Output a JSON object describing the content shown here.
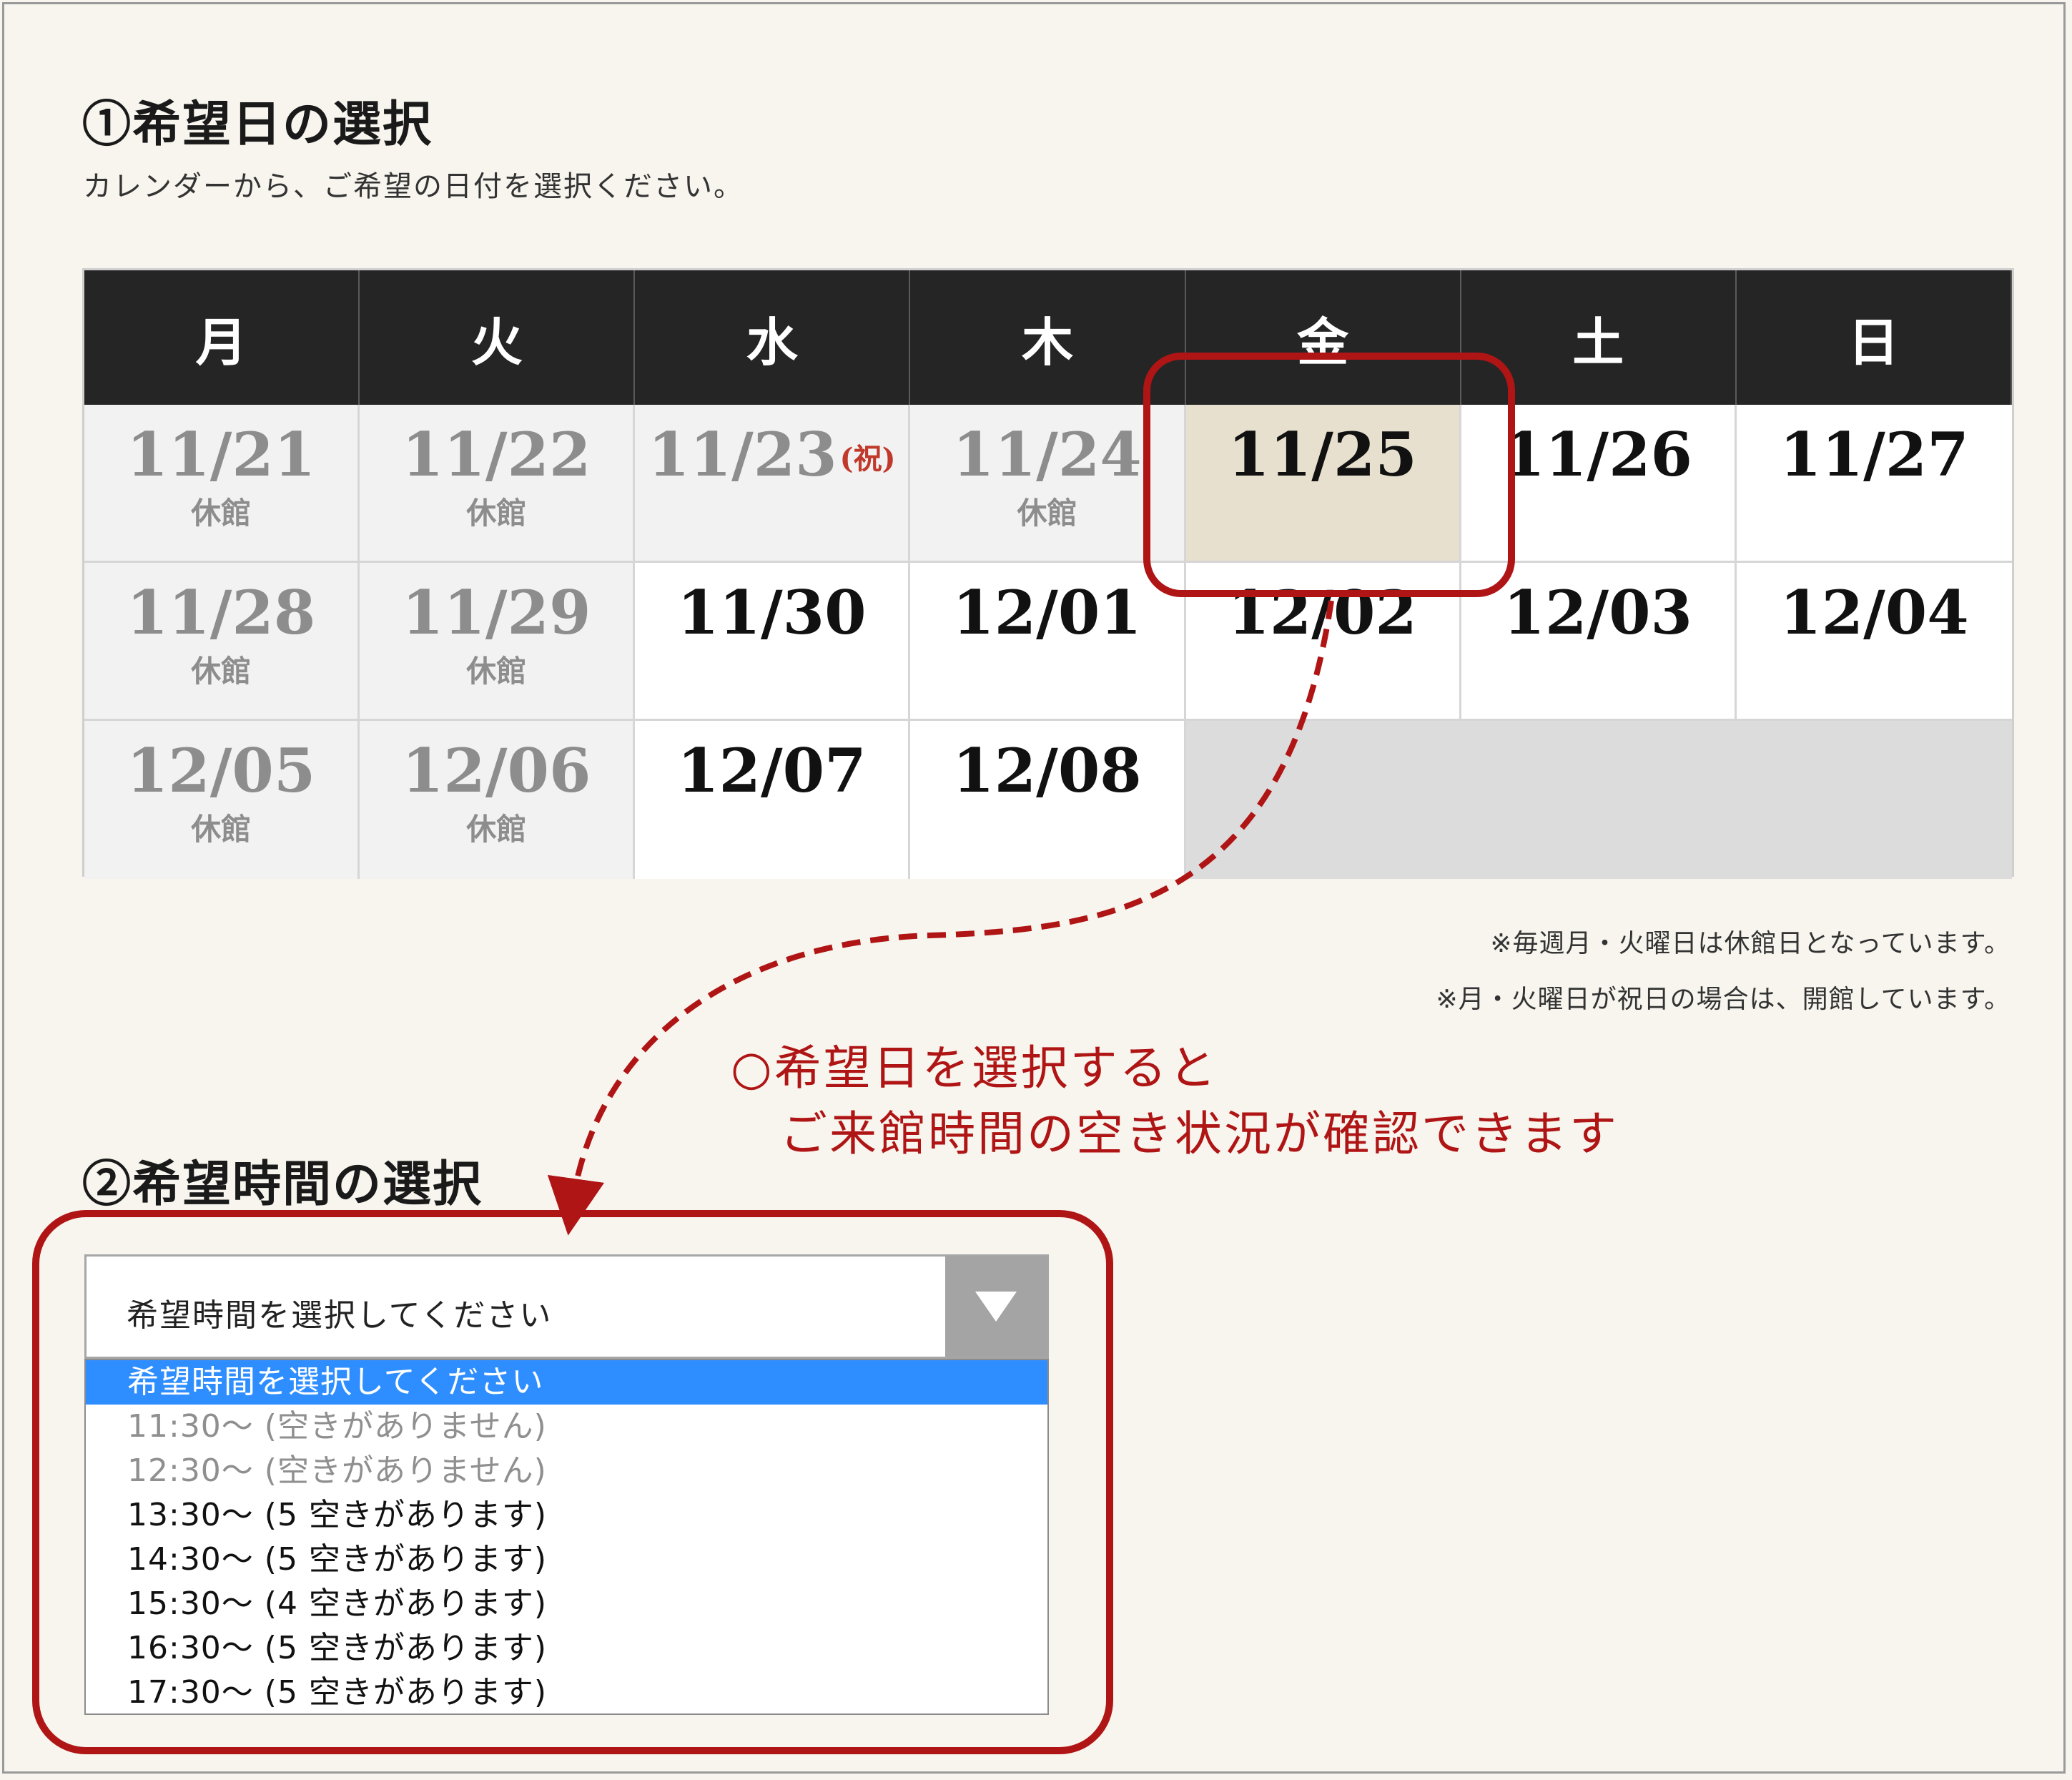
{
  "section1": {
    "title": "①希望日の選択",
    "description": "カレンダーから、ご希望の日付を選択ください。"
  },
  "calendar": {
    "weekdays": [
      "月",
      "火",
      "水",
      "木",
      "金",
      "土",
      "日"
    ],
    "holiday_mark": "(祝)",
    "closed_label": "休館",
    "rows": [
      [
        {
          "date": "11/21",
          "status": "closed",
          "note": "休館"
        },
        {
          "date": "11/22",
          "status": "closed",
          "note": "休館"
        },
        {
          "date": "11/23",
          "status": "closed",
          "holiday": "(祝)"
        },
        {
          "date": "11/24",
          "status": "closed",
          "note": "休館"
        },
        {
          "date": "11/25",
          "status": "selected"
        },
        {
          "date": "11/26",
          "status": "open"
        },
        {
          "date": "11/27",
          "status": "open"
        }
      ],
      [
        {
          "date": "11/28",
          "status": "closed",
          "note": "休館"
        },
        {
          "date": "11/29",
          "status": "closed",
          "note": "休館"
        },
        {
          "date": "11/30",
          "status": "open"
        },
        {
          "date": "12/01",
          "status": "open"
        },
        {
          "date": "12/02",
          "status": "open"
        },
        {
          "date": "12/03",
          "status": "open"
        },
        {
          "date": "12/04",
          "status": "open"
        }
      ],
      [
        {
          "date": "12/05",
          "status": "closed",
          "note": "休館"
        },
        {
          "date": "12/06",
          "status": "closed",
          "note": "休館"
        },
        {
          "date": "12/07",
          "status": "open"
        },
        {
          "date": "12/08",
          "status": "open"
        }
      ]
    ]
  },
  "footnotes": [
    "※毎週月・火曜日は休館日となっています。",
    "※月・火曜日が祝日の場合は、開館しています。"
  ],
  "callout": {
    "line1": "○希望日を選択すると",
    "line2": "　ご来館時間の空き状況が確認できます"
  },
  "section2": {
    "title": "②希望時間の選択"
  },
  "time_select": {
    "value": "希望時間を選択してください",
    "arrow_icon": "triangle-down-icon",
    "options": [
      {
        "label": "希望時間を選択してください",
        "state": "selected"
      },
      {
        "label": "11:30～ (空きがありません)",
        "state": "disabled"
      },
      {
        "label": "12:30～ (空きがありません)",
        "state": "disabled"
      },
      {
        "label": "13:30～ (5 空きがあります)",
        "state": "available"
      },
      {
        "label": "14:30～ (5 空きがあります)",
        "state": "available"
      },
      {
        "label": "15:30～ (4 空きがあります)",
        "state": "available"
      },
      {
        "label": "16:30～ (5 空きがあります)",
        "state": "available"
      },
      {
        "label": "17:30～ (5 空きがあります)",
        "state": "available"
      }
    ]
  },
  "colors": {
    "background": "#f7f5ee",
    "header": "#252525",
    "selected_date": "#e8e0cf",
    "annotation_red": "#b01515",
    "option_highlight": "#2f8eff"
  }
}
